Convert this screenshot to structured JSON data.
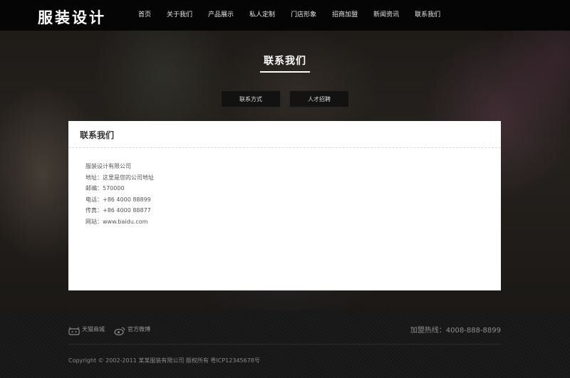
{
  "header": {
    "logo": "服装设计",
    "nav": [
      "首页",
      "关于我们",
      "产品展示",
      "私人定制",
      "门店形象",
      "招商加盟",
      "新闻资讯",
      "联系我们"
    ]
  },
  "hero": {
    "title": "联系我们",
    "tabs": [
      "联系方式",
      "人才招聘"
    ]
  },
  "panel": {
    "title": "联系我们",
    "lines": [
      "服装设计有限公司",
      "地址：这里是您的公司地址",
      "邮编：570000",
      "电话：+86 4000 88899",
      "传真：+86 4000 88877",
      "网站：www.baidu.com"
    ]
  },
  "footer": {
    "tmall_label": "天猫商城",
    "weibo_label": "官方微博",
    "hotline": "加盟热线：4008-888-8899",
    "copyright": "Copyright © 2002-2011 某某服装有限公司 版权所有   粤ICP12345678号"
  },
  "icons": {
    "tmall": "tmall-icon",
    "weibo": "weibo-icon"
  }
}
